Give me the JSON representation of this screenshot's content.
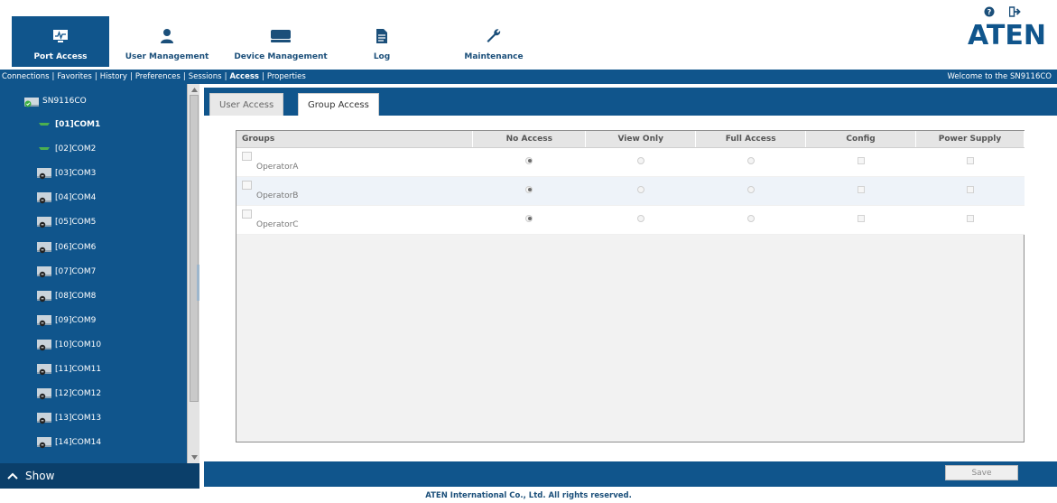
{
  "top_nav": [
    {
      "label": "Port Access",
      "icon": "port-access-icon",
      "active": true
    },
    {
      "label": "User Management",
      "icon": "user-icon",
      "active": false
    },
    {
      "label": "Device Management",
      "icon": "device-icon",
      "active": false
    },
    {
      "label": "Log",
      "icon": "log-icon",
      "active": false
    },
    {
      "label": "Maintenance",
      "icon": "wrench-icon",
      "active": false
    }
  ],
  "brand": {
    "logo_text": "ATEN"
  },
  "top_icons": [
    "help-icon",
    "logout-icon"
  ],
  "submenu": {
    "items": [
      "Connections",
      "Favorites",
      "History",
      "Preferences",
      "Sessions",
      "Access",
      "Properties"
    ],
    "current": "Access",
    "separator": "|"
  },
  "welcome_text": "Welcome to the SN9116CO",
  "sidebar": {
    "root": "SN9116CO",
    "ports": [
      {
        "label": "[01]COM1",
        "state": "connected"
      },
      {
        "label": "[02]COM2",
        "state": "connected"
      },
      {
        "label": "[03]COM3",
        "state": "offline"
      },
      {
        "label": "[04]COM4",
        "state": "offline"
      },
      {
        "label": "[05]COM5",
        "state": "offline"
      },
      {
        "label": "[06]COM6",
        "state": "offline"
      },
      {
        "label": "[07]COM7",
        "state": "offline"
      },
      {
        "label": "[08]COM8",
        "state": "offline"
      },
      {
        "label": "[09]COM9",
        "state": "offline"
      },
      {
        "label": "[10]COM10",
        "state": "offline"
      },
      {
        "label": "[11]COM11",
        "state": "offline"
      },
      {
        "label": "[12]COM12",
        "state": "offline"
      },
      {
        "label": "[13]COM13",
        "state": "offline"
      },
      {
        "label": "[14]COM14",
        "state": "offline"
      }
    ],
    "show_label": "Show"
  },
  "tabs": [
    {
      "label": "User Access",
      "active": false
    },
    {
      "label": "Group Access",
      "active": true
    }
  ],
  "table": {
    "columns": [
      "Groups",
      "No Access",
      "View Only",
      "Full Access",
      "Config",
      "Power Supply"
    ],
    "rows": [
      {
        "group": "OperatorA",
        "access": "No Access",
        "config": false,
        "power_supply": false
      },
      {
        "group": "OperatorB",
        "access": "No Access",
        "config": false,
        "power_supply": false
      },
      {
        "group": "OperatorC",
        "access": "No Access",
        "config": false,
        "power_supply": false
      }
    ]
  },
  "save_label": "Save",
  "copyright": "ATEN International Co., Ltd. All rights reserved.",
  "colors": {
    "primary": "#10558c",
    "dark": "#0b3f6a",
    "connected": "#4caf50"
  }
}
